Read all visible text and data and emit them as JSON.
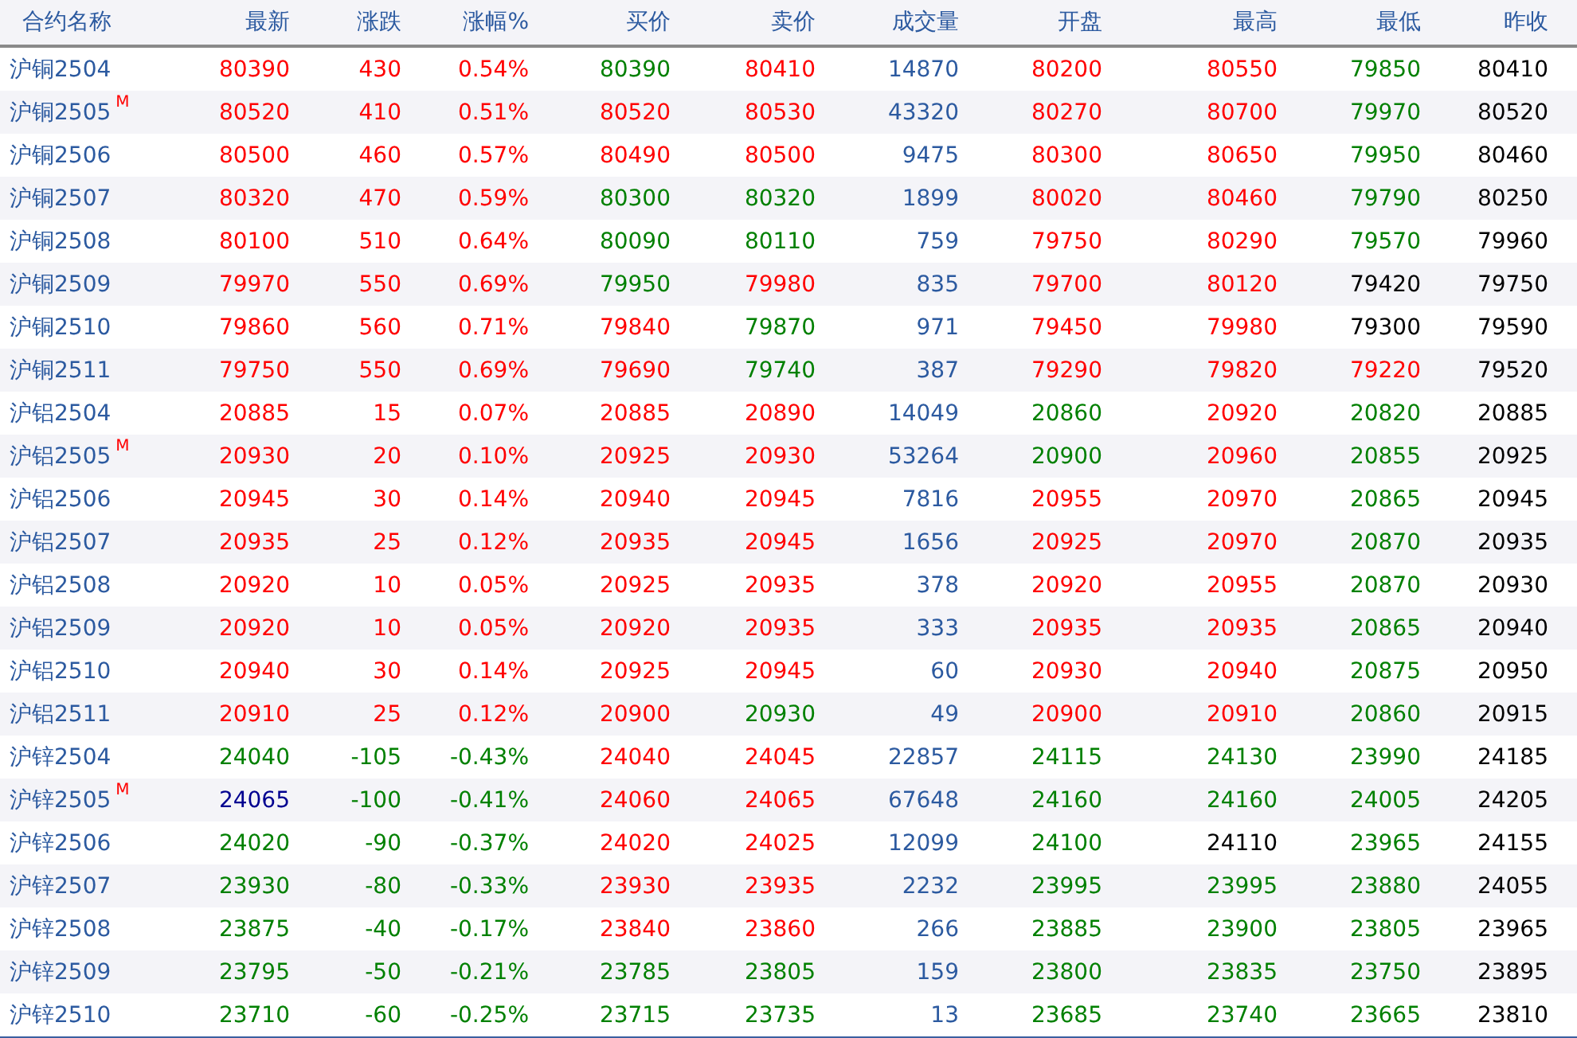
{
  "columns": [
    "合约名称",
    "最新",
    "涨跌",
    "涨幅%",
    "买价",
    "卖价",
    "成交量",
    "开盘",
    "最高",
    "最低",
    "昨收"
  ],
  "rows": [
    {
      "name": "沪铜2504",
      "cells": [
        {
          "text": "80390",
          "color": "#ff0000"
        },
        {
          "text": "430",
          "color": "#ff0000"
        },
        {
          "text": "0.54%",
          "color": "#ff0000"
        },
        {
          "text": "80390",
          "color": "#008000"
        },
        {
          "text": "80410",
          "color": "#ff0000"
        },
        {
          "text": "14870",
          "color": "#2c5aa0"
        },
        {
          "text": "80200",
          "color": "#ff0000"
        },
        {
          "text": "80550",
          "color": "#ff0000"
        },
        {
          "text": "79850",
          "color": "#008000"
        },
        {
          "text": "80410",
          "color": "#000000"
        }
      ]
    },
    {
      "name": "沪铜2505",
      "badge": "M",
      "cells": [
        {
          "text": "80520",
          "color": "#ff0000"
        },
        {
          "text": "410",
          "color": "#ff0000"
        },
        {
          "text": "0.51%",
          "color": "#ff0000"
        },
        {
          "text": "80520",
          "color": "#ff0000"
        },
        {
          "text": "80530",
          "color": "#ff0000"
        },
        {
          "text": "43320",
          "color": "#2c5aa0"
        },
        {
          "text": "80270",
          "color": "#ff0000"
        },
        {
          "text": "80700",
          "color": "#ff0000"
        },
        {
          "text": "79970",
          "color": "#008000"
        },
        {
          "text": "80520",
          "color": "#000000"
        }
      ]
    },
    {
      "name": "沪铜2506",
      "cells": [
        {
          "text": "80500",
          "color": "#ff0000"
        },
        {
          "text": "460",
          "color": "#ff0000"
        },
        {
          "text": "0.57%",
          "color": "#ff0000"
        },
        {
          "text": "80490",
          "color": "#ff0000"
        },
        {
          "text": "80500",
          "color": "#ff0000"
        },
        {
          "text": "9475",
          "color": "#2c5aa0"
        },
        {
          "text": "80300",
          "color": "#ff0000"
        },
        {
          "text": "80650",
          "color": "#ff0000"
        },
        {
          "text": "79950",
          "color": "#008000"
        },
        {
          "text": "80460",
          "color": "#000000"
        }
      ]
    },
    {
      "name": "沪铜2507",
      "cells": [
        {
          "text": "80320",
          "color": "#ff0000"
        },
        {
          "text": "470",
          "color": "#ff0000"
        },
        {
          "text": "0.59%",
          "color": "#ff0000"
        },
        {
          "text": "80300",
          "color": "#008000"
        },
        {
          "text": "80320",
          "color": "#008000"
        },
        {
          "text": "1899",
          "color": "#2c5aa0"
        },
        {
          "text": "80020",
          "color": "#ff0000"
        },
        {
          "text": "80460",
          "color": "#ff0000"
        },
        {
          "text": "79790",
          "color": "#008000"
        },
        {
          "text": "80250",
          "color": "#000000"
        }
      ]
    },
    {
      "name": "沪铜2508",
      "cells": [
        {
          "text": "80100",
          "color": "#ff0000"
        },
        {
          "text": "510",
          "color": "#ff0000"
        },
        {
          "text": "0.64%",
          "color": "#ff0000"
        },
        {
          "text": "80090",
          "color": "#008000"
        },
        {
          "text": "80110",
          "color": "#008000"
        },
        {
          "text": "759",
          "color": "#2c5aa0"
        },
        {
          "text": "79750",
          "color": "#ff0000"
        },
        {
          "text": "80290",
          "color": "#ff0000"
        },
        {
          "text": "79570",
          "color": "#008000"
        },
        {
          "text": "79960",
          "color": "#000000"
        }
      ]
    },
    {
      "name": "沪铜2509",
      "cells": [
        {
          "text": "79970",
          "color": "#ff0000"
        },
        {
          "text": "550",
          "color": "#ff0000"
        },
        {
          "text": "0.69%",
          "color": "#ff0000"
        },
        {
          "text": "79950",
          "color": "#008000"
        },
        {
          "text": "79980",
          "color": "#ff0000"
        },
        {
          "text": "835",
          "color": "#2c5aa0"
        },
        {
          "text": "79700",
          "color": "#ff0000"
        },
        {
          "text": "80120",
          "color": "#ff0000"
        },
        {
          "text": "79420",
          "color": "#000000"
        },
        {
          "text": "79750",
          "color": "#000000"
        }
      ]
    },
    {
      "name": "沪铜2510",
      "cells": [
        {
          "text": "79860",
          "color": "#ff0000"
        },
        {
          "text": "560",
          "color": "#ff0000"
        },
        {
          "text": "0.71%",
          "color": "#ff0000"
        },
        {
          "text": "79840",
          "color": "#ff0000"
        },
        {
          "text": "79870",
          "color": "#008000"
        },
        {
          "text": "971",
          "color": "#2c5aa0"
        },
        {
          "text": "79450",
          "color": "#ff0000"
        },
        {
          "text": "79980",
          "color": "#ff0000"
        },
        {
          "text": "79300",
          "color": "#000000"
        },
        {
          "text": "79590",
          "color": "#000000"
        }
      ]
    },
    {
      "name": "沪铜2511",
      "cells": [
        {
          "text": "79750",
          "color": "#ff0000"
        },
        {
          "text": "550",
          "color": "#ff0000"
        },
        {
          "text": "0.69%",
          "color": "#ff0000"
        },
        {
          "text": "79690",
          "color": "#ff0000"
        },
        {
          "text": "79740",
          "color": "#008000"
        },
        {
          "text": "387",
          "color": "#2c5aa0"
        },
        {
          "text": "79290",
          "color": "#ff0000"
        },
        {
          "text": "79820",
          "color": "#ff0000"
        },
        {
          "text": "79220",
          "color": "#ff0000"
        },
        {
          "text": "79520",
          "color": "#000000"
        }
      ]
    },
    {
      "name": "沪铝2504",
      "cells": [
        {
          "text": "20885",
          "color": "#ff0000"
        },
        {
          "text": "15",
          "color": "#ff0000"
        },
        {
          "text": "0.07%",
          "color": "#ff0000"
        },
        {
          "text": "20885",
          "color": "#ff0000"
        },
        {
          "text": "20890",
          "color": "#ff0000"
        },
        {
          "text": "14049",
          "color": "#2c5aa0"
        },
        {
          "text": "20860",
          "color": "#008000"
        },
        {
          "text": "20920",
          "color": "#ff0000"
        },
        {
          "text": "20820",
          "color": "#008000"
        },
        {
          "text": "20885",
          "color": "#000000"
        }
      ]
    },
    {
      "name": "沪铝2505",
      "badge": "M",
      "cells": [
        {
          "text": "20930",
          "color": "#ff0000"
        },
        {
          "text": "20",
          "color": "#ff0000"
        },
        {
          "text": "0.10%",
          "color": "#ff0000"
        },
        {
          "text": "20925",
          "color": "#ff0000"
        },
        {
          "text": "20930",
          "color": "#ff0000"
        },
        {
          "text": "53264",
          "color": "#2c5aa0"
        },
        {
          "text": "20900",
          "color": "#008000"
        },
        {
          "text": "20960",
          "color": "#ff0000"
        },
        {
          "text": "20855",
          "color": "#008000"
        },
        {
          "text": "20925",
          "color": "#000000"
        }
      ]
    },
    {
      "name": "沪铝2506",
      "cells": [
        {
          "text": "20945",
          "color": "#ff0000"
        },
        {
          "text": "30",
          "color": "#ff0000"
        },
        {
          "text": "0.14%",
          "color": "#ff0000"
        },
        {
          "text": "20940",
          "color": "#ff0000"
        },
        {
          "text": "20945",
          "color": "#ff0000"
        },
        {
          "text": "7816",
          "color": "#2c5aa0"
        },
        {
          "text": "20955",
          "color": "#ff0000"
        },
        {
          "text": "20970",
          "color": "#ff0000"
        },
        {
          "text": "20865",
          "color": "#008000"
        },
        {
          "text": "20945",
          "color": "#000000"
        }
      ]
    },
    {
      "name": "沪铝2507",
      "cells": [
        {
          "text": "20935",
          "color": "#ff0000"
        },
        {
          "text": "25",
          "color": "#ff0000"
        },
        {
          "text": "0.12%",
          "color": "#ff0000"
        },
        {
          "text": "20935",
          "color": "#ff0000"
        },
        {
          "text": "20945",
          "color": "#ff0000"
        },
        {
          "text": "1656",
          "color": "#2c5aa0"
        },
        {
          "text": "20925",
          "color": "#ff0000"
        },
        {
          "text": "20970",
          "color": "#ff0000"
        },
        {
          "text": "20870",
          "color": "#008000"
        },
        {
          "text": "20935",
          "color": "#000000"
        }
      ]
    },
    {
      "name": "沪铝2508",
      "cells": [
        {
          "text": "20920",
          "color": "#ff0000"
        },
        {
          "text": "10",
          "color": "#ff0000"
        },
        {
          "text": "0.05%",
          "color": "#ff0000"
        },
        {
          "text": "20925",
          "color": "#ff0000"
        },
        {
          "text": "20935",
          "color": "#ff0000"
        },
        {
          "text": "378",
          "color": "#2c5aa0"
        },
        {
          "text": "20920",
          "color": "#ff0000"
        },
        {
          "text": "20955",
          "color": "#ff0000"
        },
        {
          "text": "20870",
          "color": "#008000"
        },
        {
          "text": "20930",
          "color": "#000000"
        }
      ]
    },
    {
      "name": "沪铝2509",
      "cells": [
        {
          "text": "20920",
          "color": "#ff0000"
        },
        {
          "text": "10",
          "color": "#ff0000"
        },
        {
          "text": "0.05%",
          "color": "#ff0000"
        },
        {
          "text": "20920",
          "color": "#ff0000"
        },
        {
          "text": "20935",
          "color": "#ff0000"
        },
        {
          "text": "333",
          "color": "#2c5aa0"
        },
        {
          "text": "20935",
          "color": "#ff0000"
        },
        {
          "text": "20935",
          "color": "#ff0000"
        },
        {
          "text": "20865",
          "color": "#008000"
        },
        {
          "text": "20940",
          "color": "#000000"
        }
      ]
    },
    {
      "name": "沪铝2510",
      "cells": [
        {
          "text": "20940",
          "color": "#ff0000"
        },
        {
          "text": "30",
          "color": "#ff0000"
        },
        {
          "text": "0.14%",
          "color": "#ff0000"
        },
        {
          "text": "20925",
          "color": "#ff0000"
        },
        {
          "text": "20945",
          "color": "#ff0000"
        },
        {
          "text": "60",
          "color": "#2c5aa0"
        },
        {
          "text": "20930",
          "color": "#ff0000"
        },
        {
          "text": "20940",
          "color": "#ff0000"
        },
        {
          "text": "20875",
          "color": "#008000"
        },
        {
          "text": "20950",
          "color": "#000000"
        }
      ]
    },
    {
      "name": "沪铝2511",
      "cells": [
        {
          "text": "20910",
          "color": "#ff0000"
        },
        {
          "text": "25",
          "color": "#ff0000"
        },
        {
          "text": "0.12%",
          "color": "#ff0000"
        },
        {
          "text": "20900",
          "color": "#ff0000"
        },
        {
          "text": "20930",
          "color": "#008000"
        },
        {
          "text": "49",
          "color": "#2c5aa0"
        },
        {
          "text": "20900",
          "color": "#ff0000"
        },
        {
          "text": "20910",
          "color": "#ff0000"
        },
        {
          "text": "20860",
          "color": "#008000"
        },
        {
          "text": "20915",
          "color": "#000000"
        }
      ]
    },
    {
      "name": "沪锌2504",
      "cells": [
        {
          "text": "24040",
          "color": "#008000"
        },
        {
          "text": "-105",
          "color": "#008000"
        },
        {
          "text": "-0.43%",
          "color": "#008000"
        },
        {
          "text": "24040",
          "color": "#ff0000"
        },
        {
          "text": "24045",
          "color": "#ff0000"
        },
        {
          "text": "22857",
          "color": "#2c5aa0"
        },
        {
          "text": "24115",
          "color": "#008000"
        },
        {
          "text": "24130",
          "color": "#008000"
        },
        {
          "text": "23990",
          "color": "#008000"
        },
        {
          "text": "24185",
          "color": "#000000"
        }
      ]
    },
    {
      "name": "沪锌2505",
      "badge": "M",
      "cells": [
        {
          "text": "24065",
          "color": "#000090"
        },
        {
          "text": "-100",
          "color": "#008000"
        },
        {
          "text": "-0.41%",
          "color": "#008000"
        },
        {
          "text": "24060",
          "color": "#ff0000"
        },
        {
          "text": "24065",
          "color": "#ff0000"
        },
        {
          "text": "67648",
          "color": "#2c5aa0"
        },
        {
          "text": "24160",
          "color": "#008000"
        },
        {
          "text": "24160",
          "color": "#008000"
        },
        {
          "text": "24005",
          "color": "#008000"
        },
        {
          "text": "24205",
          "color": "#000000"
        }
      ]
    },
    {
      "name": "沪锌2506",
      "cells": [
        {
          "text": "24020",
          "color": "#008000"
        },
        {
          "text": "-90",
          "color": "#008000"
        },
        {
          "text": "-0.37%",
          "color": "#008000"
        },
        {
          "text": "24020",
          "color": "#ff0000"
        },
        {
          "text": "24025",
          "color": "#ff0000"
        },
        {
          "text": "12099",
          "color": "#2c5aa0"
        },
        {
          "text": "24100",
          "color": "#008000"
        },
        {
          "text": "24110",
          "color": "#000000"
        },
        {
          "text": "23965",
          "color": "#008000"
        },
        {
          "text": "24155",
          "color": "#000000"
        }
      ]
    },
    {
      "name": "沪锌2507",
      "cells": [
        {
          "text": "23930",
          "color": "#008000"
        },
        {
          "text": "-80",
          "color": "#008000"
        },
        {
          "text": "-0.33%",
          "color": "#008000"
        },
        {
          "text": "23930",
          "color": "#ff0000"
        },
        {
          "text": "23935",
          "color": "#ff0000"
        },
        {
          "text": "2232",
          "color": "#2c5aa0"
        },
        {
          "text": "23995",
          "color": "#008000"
        },
        {
          "text": "23995",
          "color": "#008000"
        },
        {
          "text": "23880",
          "color": "#008000"
        },
        {
          "text": "24055",
          "color": "#000000"
        }
      ]
    },
    {
      "name": "沪锌2508",
      "cells": [
        {
          "text": "23875",
          "color": "#008000"
        },
        {
          "text": "-40",
          "color": "#008000"
        },
        {
          "text": "-0.17%",
          "color": "#008000"
        },
        {
          "text": "23840",
          "color": "#ff0000"
        },
        {
          "text": "23860",
          "color": "#ff0000"
        },
        {
          "text": "266",
          "color": "#2c5aa0"
        },
        {
          "text": "23885",
          "color": "#008000"
        },
        {
          "text": "23900",
          "color": "#008000"
        },
        {
          "text": "23805",
          "color": "#008000"
        },
        {
          "text": "23965",
          "color": "#000000"
        }
      ]
    },
    {
      "name": "沪锌2509",
      "cells": [
        {
          "text": "23795",
          "color": "#008000"
        },
        {
          "text": "-50",
          "color": "#008000"
        },
        {
          "text": "-0.21%",
          "color": "#008000"
        },
        {
          "text": "23785",
          "color": "#008000"
        },
        {
          "text": "23805",
          "color": "#008000"
        },
        {
          "text": "159",
          "color": "#2c5aa0"
        },
        {
          "text": "23800",
          "color": "#008000"
        },
        {
          "text": "23835",
          "color": "#008000"
        },
        {
          "text": "23750",
          "color": "#008000"
        },
        {
          "text": "23895",
          "color": "#000000"
        }
      ]
    },
    {
      "name": "沪锌2510",
      "cells": [
        {
          "text": "23710",
          "color": "#008000"
        },
        {
          "text": "-60",
          "color": "#008000"
        },
        {
          "text": "-0.25%",
          "color": "#008000"
        },
        {
          "text": "23715",
          "color": "#008000"
        },
        {
          "text": "23735",
          "color": "#008000"
        },
        {
          "text": "13",
          "color": "#2c5aa0"
        },
        {
          "text": "23685",
          "color": "#008000"
        },
        {
          "text": "23740",
          "color": "#008000"
        },
        {
          "text": "23665",
          "color": "#008000"
        },
        {
          "text": "23810",
          "color": "#000000"
        }
      ]
    }
  ]
}
